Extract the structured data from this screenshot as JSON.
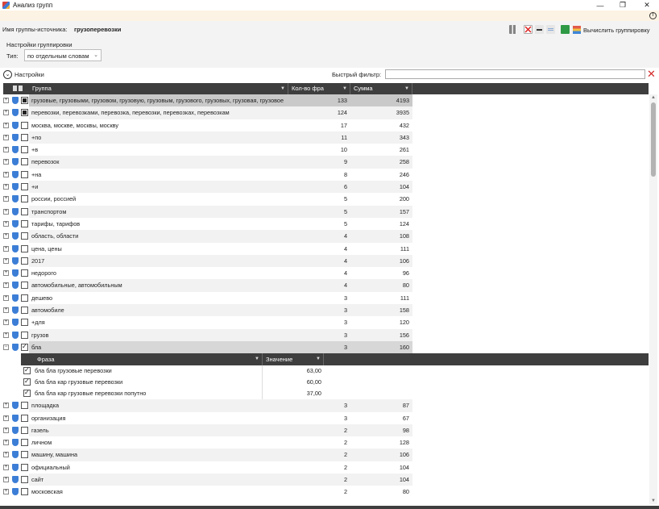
{
  "window": {
    "title": "Анализ групп",
    "minimize": "—",
    "maximize": "❐",
    "close": "✕"
  },
  "source": {
    "label": "Имя группы-источника:",
    "value": "грузоперевозки"
  },
  "toolbar": {
    "calculate_label": "Вычислить группировку"
  },
  "grouping": {
    "title": "Настройки группировки",
    "type_label": "Тип:",
    "type_value": "по отдельным словам"
  },
  "settings_label": "Настройки",
  "quick_filter": {
    "label": "Быстрый фильтр:",
    "value": ""
  },
  "columns": {
    "group": "Группа",
    "count": "Кол-во фра",
    "sum": "Сумма"
  },
  "detail_columns": {
    "phrase": "Фраза",
    "value": "Значение"
  },
  "rows_before": [
    {
      "group": "грузовые, грузовыми, грузовом, грузовую, грузовым, грузового, грузовых, грузовая, грузовое",
      "count": "133",
      "sum": "4193",
      "check": "filled",
      "state": "sel"
    },
    {
      "group": "перевозки, перевозками, перевозка, перевозки, перевозках, перевозкам",
      "count": "124",
      "sum": "3935",
      "check": "filled",
      "state": ""
    },
    {
      "group": "москва, москве, москвы, москву",
      "count": "17",
      "sum": "432",
      "check": "",
      "state": ""
    },
    {
      "group": "+по",
      "count": "11",
      "sum": "343",
      "check": "",
      "state": ""
    },
    {
      "group": "+в",
      "count": "10",
      "sum": "261",
      "check": "",
      "state": ""
    },
    {
      "group": "перевозок",
      "count": "9",
      "sum": "258",
      "check": "",
      "state": ""
    },
    {
      "group": "+на",
      "count": "8",
      "sum": "246",
      "check": "",
      "state": ""
    },
    {
      "group": "+и",
      "count": "6",
      "sum": "104",
      "check": "",
      "state": ""
    },
    {
      "group": "россии, россией",
      "count": "5",
      "sum": "200",
      "check": "",
      "state": ""
    },
    {
      "group": "транспортом",
      "count": "5",
      "sum": "157",
      "check": "",
      "state": ""
    },
    {
      "group": "тарифы, тарифов",
      "count": "5",
      "sum": "124",
      "check": "",
      "state": ""
    },
    {
      "group": "область, области",
      "count": "4",
      "sum": "108",
      "check": "",
      "state": ""
    },
    {
      "group": "цена, цены",
      "count": "4",
      "sum": "111",
      "check": "",
      "state": ""
    },
    {
      "group": "2017",
      "count": "4",
      "sum": "106",
      "check": "",
      "state": ""
    },
    {
      "group": "недорого",
      "count": "4",
      "sum": "96",
      "check": "",
      "state": ""
    },
    {
      "group": "автомобильные, автомобильным",
      "count": "4",
      "sum": "80",
      "check": "",
      "state": ""
    },
    {
      "group": "дешево",
      "count": "3",
      "sum": "111",
      "check": "",
      "state": ""
    },
    {
      "group": "автомобиле",
      "count": "3",
      "sum": "158",
      "check": "",
      "state": ""
    },
    {
      "group": "+для",
      "count": "3",
      "sum": "120",
      "check": "",
      "state": ""
    },
    {
      "group": "грузов",
      "count": "3",
      "sum": "156",
      "check": "",
      "state": ""
    },
    {
      "group": "бла",
      "count": "3",
      "sum": "160",
      "check": "checked",
      "state": "exp"
    }
  ],
  "detail_rows": [
    {
      "phrase": "бла бла грузовые перевозки",
      "value": "63,00"
    },
    {
      "phrase": "бла бла кар грузовые перевозки",
      "value": "60,00"
    },
    {
      "phrase": "бла бла кар грузовые перевозки попутно",
      "value": "37,00"
    }
  ],
  "rows_after": [
    {
      "group": "площадка",
      "count": "3",
      "sum": "87",
      "check": "",
      "state": ""
    },
    {
      "group": "организация",
      "count": "3",
      "sum": "67",
      "check": "",
      "state": ""
    },
    {
      "group": "газель",
      "count": "2",
      "sum": "98",
      "check": "",
      "state": ""
    },
    {
      "group": "личном",
      "count": "2",
      "sum": "128",
      "check": "",
      "state": ""
    },
    {
      "group": "машину, машина",
      "count": "2",
      "sum": "106",
      "check": "",
      "state": ""
    },
    {
      "group": "официальный",
      "count": "2",
      "sum": "104",
      "check": "",
      "state": ""
    },
    {
      "group": "сайт",
      "count": "2",
      "sum": "104",
      "check": "",
      "state": ""
    },
    {
      "group": "московская",
      "count": "2",
      "sum": "80",
      "check": "",
      "state": ""
    }
  ]
}
